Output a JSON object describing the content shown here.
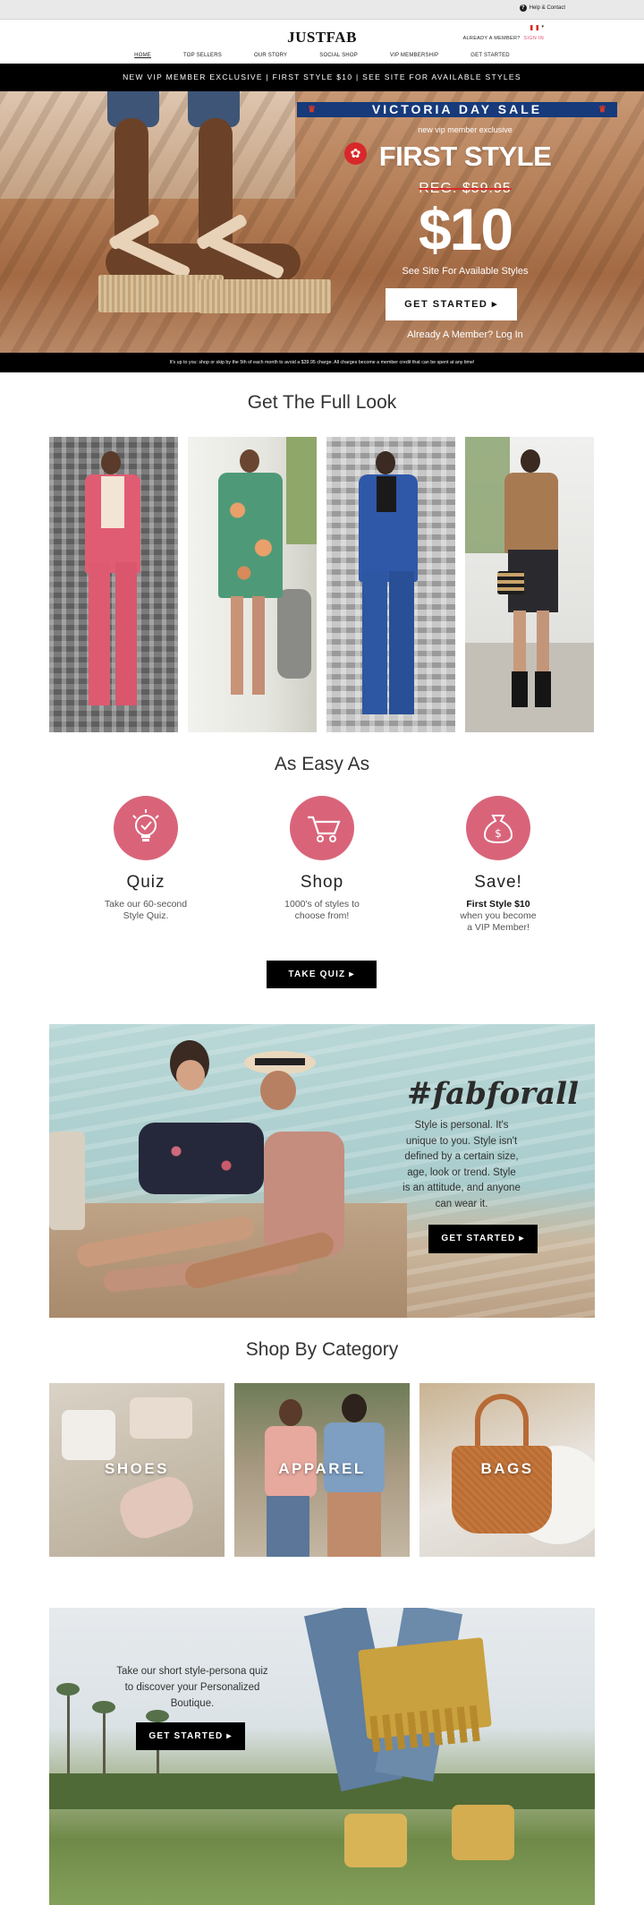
{
  "utility": {
    "help_label": "Help & Contact"
  },
  "header": {
    "logo": "JUSTFAB",
    "member_prompt": "ALREADY A MEMBER?",
    "sign_in": "SIGN IN",
    "nav": [
      "HOME",
      "TOP SELLERS",
      "OUR STORY",
      "SOCIAL SHOP",
      "VIP MEMBERSHIP",
      "GET STARTED"
    ]
  },
  "promo_bar": {
    "text": "NEW VIP MEMBER EXCLUSIVE | FIRST STYLE $10 | SEE SITE FOR AVAILABLE STYLES"
  },
  "hero": {
    "sale_banner": "VICTORIA DAY SALE",
    "vip_exclusive": "new vip member exclusive",
    "headline": "FIRST STYLE",
    "regular_price": "REG. $59.95",
    "price": "$10",
    "see_site": "See Site For Available Styles",
    "cta": "GET STARTED ▸",
    "already_member": "Already A Member? Log In",
    "disclaimer": "It's up to you: shop or skip by the 5th of each month to avoid a $39.95 charge. All charges become a member credit that can be spent at any time!"
  },
  "full_look": {
    "title": "Get The Full Look"
  },
  "easy": {
    "title": "As Easy As",
    "steps": [
      {
        "icon": "lightbulb-check-icon",
        "name": "Quiz",
        "line1": "Take our 60-second",
        "line2": "Style Quiz."
      },
      {
        "icon": "shopping-cart-icon",
        "name": "Shop",
        "line1": "1000's of styles to",
        "line2": "choose from!"
      },
      {
        "icon": "money-bag-icon",
        "name": "Save!",
        "bold": "First Style $10",
        "line1": "when you become",
        "line2": "a VIP Member!"
      }
    ],
    "cta": "TAKE QUIZ ▸"
  },
  "fab": {
    "title": "#fabforall",
    "text": "Style is personal. It's unique to you. Style isn't defined by a certain size, age, look or trend. Style is an attitude, and anyone can wear it.",
    "cta": "GET STARTED ▸"
  },
  "category": {
    "title": "Shop By Category",
    "items": [
      "SHOES",
      "APPAREL",
      "BAGS"
    ]
  },
  "bottom": {
    "text": "Take our short style-persona quiz to discover your Personalized Boutique.",
    "cta": "GET STARTED ▸"
  },
  "colors": {
    "accent_pink": "#e0567a",
    "icon_circle": "#d9647a",
    "sale_blue": "#163a7a",
    "black": "#000000"
  }
}
